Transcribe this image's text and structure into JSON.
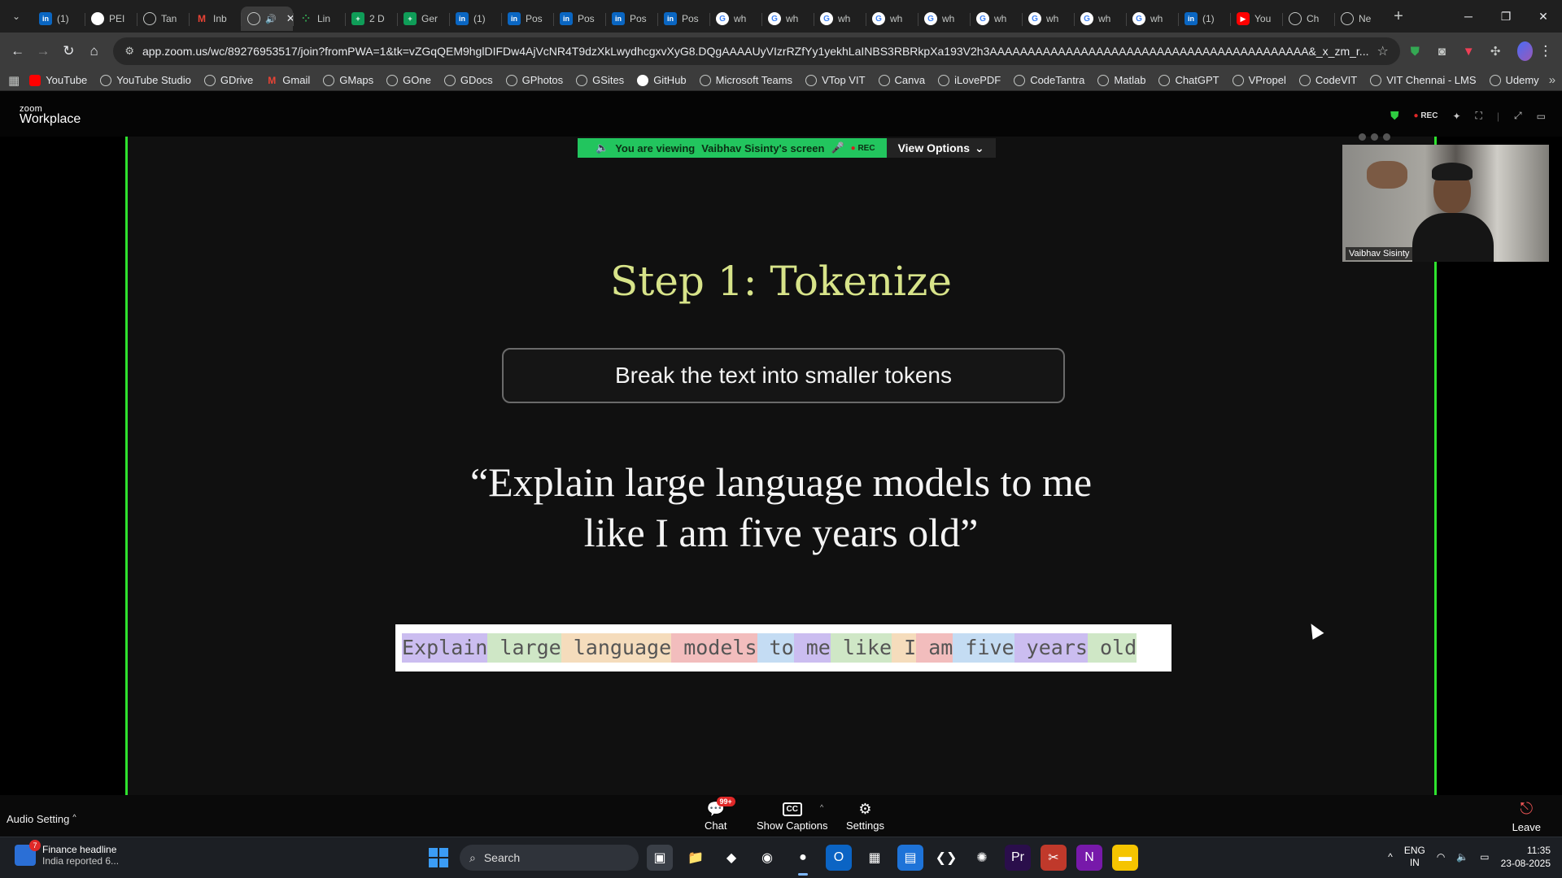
{
  "browser": {
    "tabs": [
      {
        "label": "(1)",
        "icon": "linkedin-icon",
        "fav": "li",
        "favtext": "in"
      },
      {
        "label": "PEI",
        "icon": "github-icon",
        "fav": "gh",
        "favtext": ""
      },
      {
        "label": "Tan",
        "icon": "globe-icon",
        "fav": "globe",
        "favtext": ""
      },
      {
        "label": "Inb",
        "icon": "gmail-icon",
        "fav": "gm",
        "favtext": "M"
      },
      {
        "label": "",
        "icon": "speaker-icon",
        "fav": "globe",
        "favtext": "",
        "active": true
      },
      {
        "label": "Lin",
        "icon": "dots-icon",
        "fav": "dots",
        "favtext": "⁘"
      },
      {
        "label": "2 D",
        "icon": "sheets-icon",
        "fav": "sheet",
        "favtext": "+"
      },
      {
        "label": "Ger",
        "icon": "sheets-icon",
        "fav": "sheet",
        "favtext": "+"
      },
      {
        "label": "(1)",
        "icon": "linkedin-icon",
        "fav": "li",
        "favtext": "in"
      },
      {
        "label": "Pos",
        "icon": "linkedin-icon",
        "fav": "li",
        "favtext": "in"
      },
      {
        "label": "Pos",
        "icon": "linkedin-icon",
        "fav": "li",
        "favtext": "in"
      },
      {
        "label": "Pos",
        "icon": "linkedin-icon",
        "fav": "li",
        "favtext": "in"
      },
      {
        "label": "Pos",
        "icon": "linkedin-icon",
        "fav": "li",
        "favtext": "in"
      },
      {
        "label": "wh",
        "icon": "google-icon",
        "fav": "g",
        "favtext": "G"
      },
      {
        "label": "wh",
        "icon": "google-icon",
        "fav": "g",
        "favtext": "G"
      },
      {
        "label": "wh",
        "icon": "google-icon",
        "fav": "g",
        "favtext": "G"
      },
      {
        "label": "wh",
        "icon": "google-icon",
        "fav": "g",
        "favtext": "G"
      },
      {
        "label": "wh",
        "icon": "google-icon",
        "fav": "g",
        "favtext": "G"
      },
      {
        "label": "wh",
        "icon": "google-icon",
        "fav": "g",
        "favtext": "G"
      },
      {
        "label": "wh",
        "icon": "google-icon",
        "fav": "g",
        "favtext": "G"
      },
      {
        "label": "wh",
        "icon": "google-icon",
        "fav": "g",
        "favtext": "G"
      },
      {
        "label": "wh",
        "icon": "google-icon",
        "fav": "g",
        "favtext": "G"
      },
      {
        "label": "(1)",
        "icon": "linkedin-icon",
        "fav": "li",
        "favtext": "in"
      },
      {
        "label": "You",
        "icon": "youtube-icon",
        "fav": "yt",
        "favtext": "▶"
      },
      {
        "label": "Ch",
        "icon": "chatgpt-icon",
        "fav": "globe",
        "favtext": ""
      },
      {
        "label": "Ne",
        "icon": "globe-icon",
        "fav": "globe",
        "favtext": ""
      }
    ],
    "url": "app.zoom.us/wc/89276953517/join?fromPWA=1&tk=vZGqQEM9hglDIFDw4AjVcNR4T9dzXkLwydhcgxvXyG8.DQgAAAAUyVIzrRZfYy1yekhLaINBS3RBRkpXa193V2h3AAAAAAAAAAAAAAAAAAAAAAAAAAAAAAAAAAAAAAAAAA&_x_zm_r...",
    "bookmarks": [
      {
        "label": "YouTube",
        "icon": "yt"
      },
      {
        "label": "YouTube Studio",
        "icon": ""
      },
      {
        "label": "GDrive",
        "icon": ""
      },
      {
        "label": "Gmail",
        "icon": "gm"
      },
      {
        "label": "GMaps",
        "icon": ""
      },
      {
        "label": "GOne",
        "icon": ""
      },
      {
        "label": "GDocs",
        "icon": ""
      },
      {
        "label": "GPhotos",
        "icon": ""
      },
      {
        "label": "GSites",
        "icon": ""
      },
      {
        "label": "GitHub",
        "icon": "gh"
      },
      {
        "label": "Microsoft Teams",
        "icon": ""
      },
      {
        "label": "VTop VIT",
        "icon": ""
      },
      {
        "label": "Canva",
        "icon": ""
      },
      {
        "label": "iLovePDF",
        "icon": ""
      },
      {
        "label": "CodeTantra",
        "icon": ""
      },
      {
        "label": "Matlab",
        "icon": ""
      },
      {
        "label": "ChatGPT",
        "icon": ""
      },
      {
        "label": "VPropel",
        "icon": ""
      },
      {
        "label": "CodeVIT",
        "icon": ""
      },
      {
        "label": "VIT Chennai - LMS",
        "icon": ""
      },
      {
        "label": "Udemy",
        "icon": ""
      }
    ]
  },
  "zoom": {
    "logo_top": "zoom",
    "logo_bottom": "Workplace",
    "rec_label": "REC",
    "viewing_prefix": "You are viewing",
    "viewing_name": "Vaibhav Sisinty's screen",
    "viewing_rec": "REC",
    "view_options": "View Options",
    "participant_name": "Vaibhav Sisinty",
    "footer": {
      "audio_setting": "Audio Setting",
      "chat": "Chat",
      "chat_badge": "99+",
      "captions": "Show Captions",
      "settings": "Settings",
      "leave": "Leave"
    }
  },
  "slide": {
    "title": "Step 1: Tokenize",
    "subtitle": "Break the text into smaller tokens",
    "quote_line1": "“Explain large language models to me",
    "quote_line2": "like I am five years old”",
    "tokens": [
      {
        "text": "Explain",
        "color": "#cbbdf0"
      },
      {
        "text": " large",
        "color": "#cfe7c6"
      },
      {
        "text": " language",
        "color": "#f5dcbc"
      },
      {
        "text": " models",
        "color": "#f2bdbd"
      },
      {
        "text": " to",
        "color": "#c4dcf3"
      },
      {
        "text": " me",
        "color": "#cbbdf0"
      },
      {
        "text": " like",
        "color": "#cfe7c6"
      },
      {
        "text": " I",
        "color": "#f5dcbc"
      },
      {
        "text": " am",
        "color": "#f2bdbd"
      },
      {
        "text": " five",
        "color": "#c4dcf3"
      },
      {
        "text": " years",
        "color": "#cbbdf0"
      },
      {
        "text": " old",
        "color": "#cfe7c6"
      }
    ]
  },
  "taskbar": {
    "weather_title": "Finance headline",
    "weather_sub": "India reported 6...",
    "weather_badge": "7",
    "search": "Search",
    "lang1": "ENG",
    "lang2": "IN",
    "time": "11:35",
    "date": "23-08-2025",
    "apps": [
      {
        "name": "task-view-icon",
        "glyph": "▣",
        "bg": "#3a3f47"
      },
      {
        "name": "file-explorer-icon",
        "glyph": "📁",
        "bg": "transparent"
      },
      {
        "name": "copilot-icon",
        "glyph": "◆",
        "bg": "transparent"
      },
      {
        "name": "edge-icon",
        "glyph": "◉",
        "bg": "transparent"
      },
      {
        "name": "chrome-icon",
        "glyph": "●",
        "bg": "transparent",
        "active": true
      },
      {
        "name": "outlook-icon",
        "glyph": "O",
        "bg": "#0b64c4"
      },
      {
        "name": "store-icon",
        "glyph": "▦",
        "bg": "transparent"
      },
      {
        "name": "app-icon",
        "glyph": "▤",
        "bg": "#1e73d8"
      },
      {
        "name": "vscode-icon",
        "glyph": "❮❯",
        "bg": "transparent"
      },
      {
        "name": "chatgpt-icon",
        "glyph": "✺",
        "bg": "transparent"
      },
      {
        "name": "premiere-icon",
        "glyph": "Pr",
        "bg": "#2a0e4b"
      },
      {
        "name": "snipping-icon",
        "glyph": "✂",
        "bg": "#c0392b"
      },
      {
        "name": "onenote-icon",
        "glyph": "N",
        "bg": "#7719aa"
      },
      {
        "name": "sticky-notes-icon",
        "glyph": "▬",
        "bg": "#f5c400"
      }
    ]
  }
}
